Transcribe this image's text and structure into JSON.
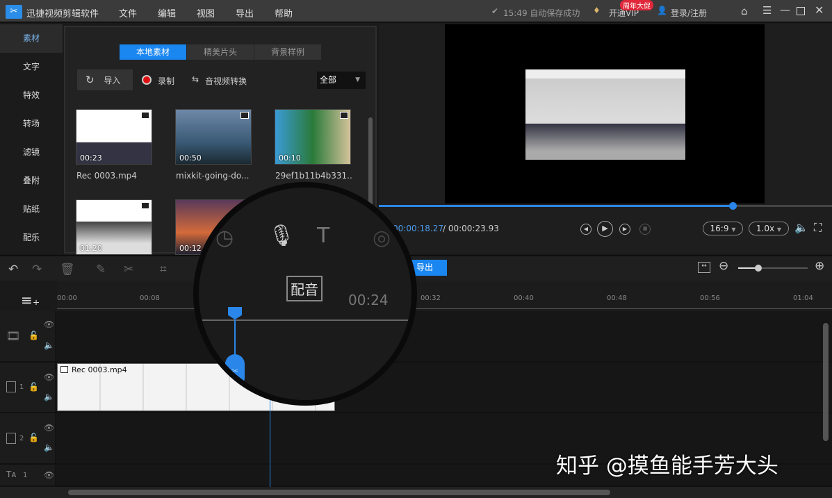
{
  "app": {
    "title": "迅捷视频剪辑软件",
    "menu": [
      "文件",
      "编辑",
      "视图",
      "导出",
      "帮助"
    ],
    "autosave": "15:49 自动保存成功",
    "vip": "开通VIP",
    "vip_badge": "周年大促",
    "login": "登录/注册"
  },
  "sidebar": [
    "素材",
    "文字",
    "特效",
    "转场",
    "滤镜",
    "叠附",
    "贴纸",
    "配乐"
  ],
  "media": {
    "tabs": [
      "本地素材",
      "精美片头",
      "背景样例"
    ],
    "import": "导入",
    "record": "录制",
    "convert": "音视频转换",
    "filter": "全部",
    "items": [
      {
        "name": "Rec 0003.mp4",
        "duration": "00:23"
      },
      {
        "name": "mixkit-going-do...",
        "duration": "00:50"
      },
      {
        "name": "29ef1b11b4b331...",
        "duration": "00:10"
      },
      {
        "name": "",
        "duration": "01:20"
      },
      {
        "name": "",
        "duration": "00:12"
      }
    ]
  },
  "player": {
    "current": "00:00:18.27",
    "total": "/ 00:00:23.93",
    "ratio": "16:9",
    "speed": "1.0x",
    "progress": 0.78
  },
  "toolbar": {
    "export": "导出"
  },
  "ruler": [
    "00:00",
    "00:08",
    "00:32",
    "00:40",
    "00:48",
    "00:56",
    "01:04"
  ],
  "magnifier": {
    "dub_label": "配音",
    "time": "00:24"
  },
  "tracks": {
    "clip": "Rec 0003.mp4",
    "labels": [
      "1",
      "2",
      "1"
    ]
  },
  "watermark": "知乎 @摸鱼能手芳大头"
}
